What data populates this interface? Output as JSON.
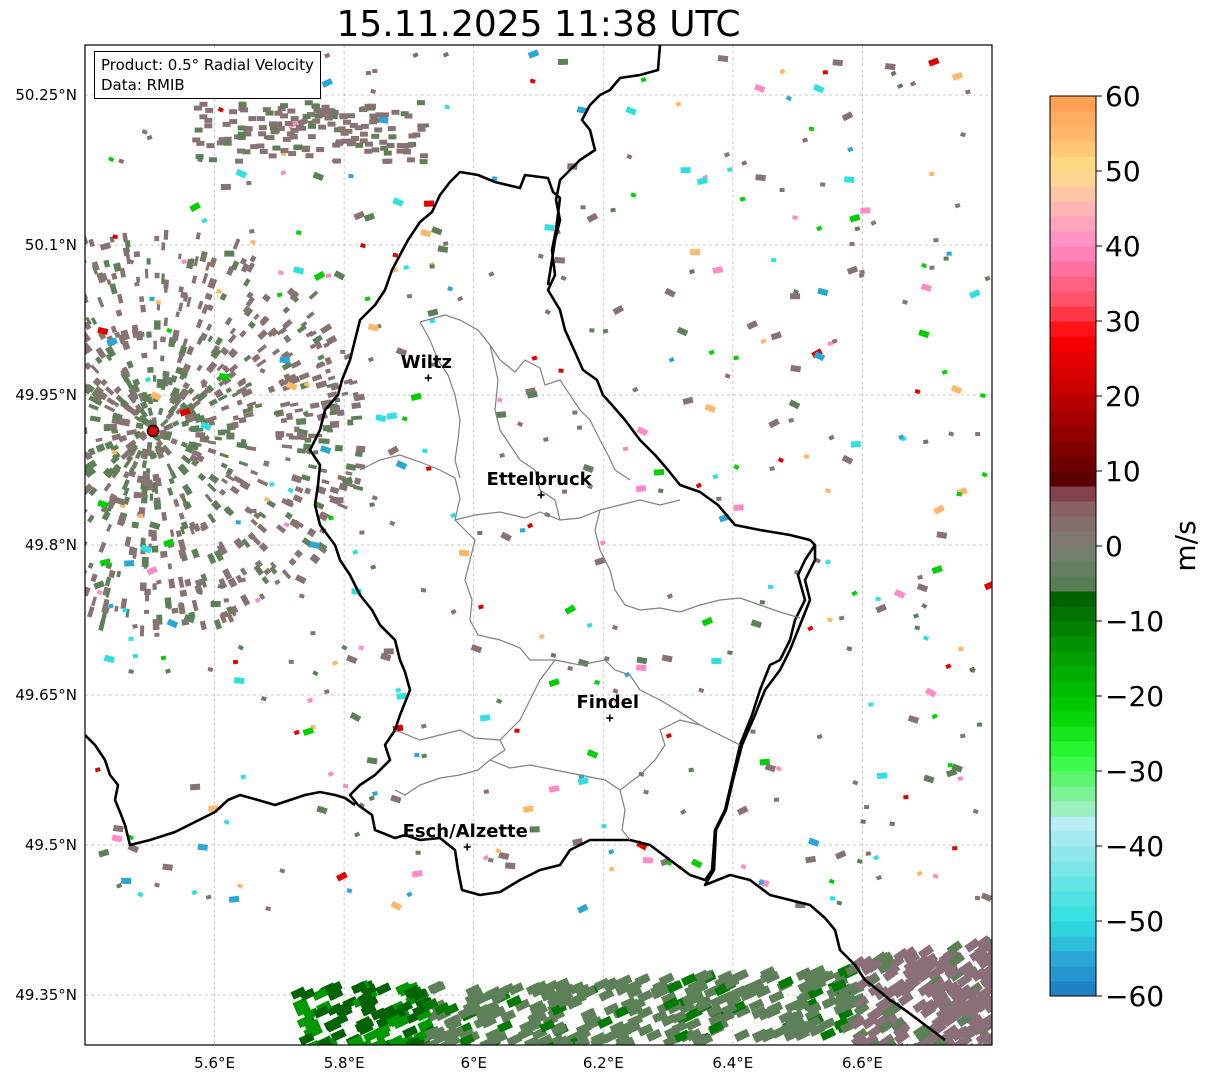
{
  "title": "15.11.2025 11:38 UTC",
  "info": {
    "product": "Product: 0.5° Radial Velocity",
    "data": "Data: RMIB"
  },
  "map": {
    "lon_range": [
      5.4,
      6.8
    ],
    "lat_range": [
      49.3,
      50.3
    ],
    "lon_ticks": [
      {
        "value": 5.6,
        "label": "5.6°E"
      },
      {
        "value": 5.8,
        "label": "5.8°E"
      },
      {
        "value": 6.0,
        "label": "6°E"
      },
      {
        "value": 6.2,
        "label": "6.2°E"
      },
      {
        "value": 6.4,
        "label": "6.4°E"
      },
      {
        "value": 6.6,
        "label": "6.6°E"
      }
    ],
    "lat_ticks": [
      {
        "value": 50.25,
        "label": "50.25°N"
      },
      {
        "value": 50.1,
        "label": "50.1°N"
      },
      {
        "value": 49.95,
        "label": "49.95°N"
      },
      {
        "value": 49.8,
        "label": "49.8°N"
      },
      {
        "value": 49.65,
        "label": "49.65°N"
      },
      {
        "value": 49.5,
        "label": "49.5°N"
      },
      {
        "value": 49.35,
        "label": "49.35°N"
      }
    ],
    "gridlines": true,
    "radar_site": {
      "lon": 5.505,
      "lat": 49.914
    },
    "cities": [
      {
        "name": "Wiltz",
        "lon": 5.93,
        "lat": 49.967
      },
      {
        "name": "Ettelbruck",
        "lon": 6.104,
        "lat": 49.85
      },
      {
        "name": "Findel",
        "lon": 6.21,
        "lat": 49.627
      },
      {
        "name": "Esch/Alzette",
        "lon": 5.99,
        "lat": 49.498
      }
    ]
  },
  "colorbar": {
    "unit": "m/s",
    "min": -60,
    "max": 60,
    "ticks": [
      {
        "value": 60,
        "label": "60"
      },
      {
        "value": 50,
        "label": "50"
      },
      {
        "value": 40,
        "label": "40"
      },
      {
        "value": 30,
        "label": "30"
      },
      {
        "value": 20,
        "label": "20"
      },
      {
        "value": 10,
        "label": "10"
      },
      {
        "value": 0,
        "label": "0"
      },
      {
        "value": -10,
        "label": "−10"
      },
      {
        "value": -20,
        "label": "−20"
      },
      {
        "value": -30,
        "label": "−30"
      },
      {
        "value": -40,
        "label": "−40"
      },
      {
        "value": -50,
        "label": "−50"
      },
      {
        "value": -60,
        "label": "−60"
      }
    ],
    "stops": [
      {
        "v": -60,
        "color": "#1f78c1"
      },
      {
        "v": -55,
        "color": "#2aa7d6"
      },
      {
        "v": -50,
        "color": "#2ee0e0"
      },
      {
        "v": -40,
        "color": "#9be8ec"
      },
      {
        "v": -37,
        "color": "#b9eef2"
      },
      {
        "v": -34,
        "color": "#8ef0a8"
      },
      {
        "v": -28,
        "color": "#2efc3a"
      },
      {
        "v": -22,
        "color": "#00d000"
      },
      {
        "v": -14,
        "color": "#009a00"
      },
      {
        "v": -7,
        "color": "#006200"
      },
      {
        "v": -6,
        "color": "#4f7d4f"
      },
      {
        "v": 0,
        "color": "#7d7f73"
      },
      {
        "v": 6,
        "color": "#8a5a66"
      },
      {
        "v": 8,
        "color": "#7a2a35"
      },
      {
        "v": 9,
        "color": "#5c0000"
      },
      {
        "v": 20,
        "color": "#c00000"
      },
      {
        "v": 28,
        "color": "#ff0000"
      },
      {
        "v": 32,
        "color": "#ff4a5e"
      },
      {
        "v": 40,
        "color": "#ff8ac6"
      },
      {
        "v": 45,
        "color": "#ffb5b5"
      },
      {
        "v": 50,
        "color": "#ffe08a"
      },
      {
        "v": 55,
        "color": "#ffb86a"
      },
      {
        "v": 60,
        "color": "#ff9a50"
      }
    ]
  },
  "colors": {
    "clutter_gray": "#887373",
    "clutter_green": "#5d8058",
    "border": "#000000",
    "admin_lines": "#808080"
  }
}
